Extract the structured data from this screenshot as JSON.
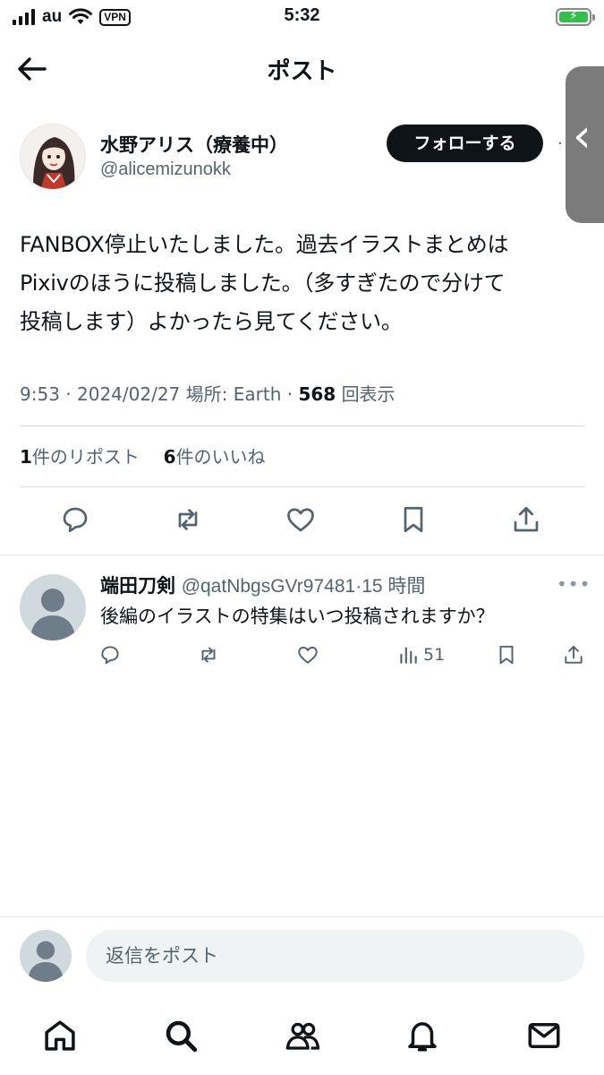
{
  "status_bar": {
    "carrier": "au",
    "vpn": "VPN",
    "time": "5:32"
  },
  "header": {
    "title": "ポスト"
  },
  "author": {
    "name": "水野アリス（療養中）",
    "handle": "@alicemizunokk",
    "follow_label": "フォローする"
  },
  "post": {
    "lines": [
      "FANBOX停止いたしました。過去イラストまとめは",
      "Pixivのほうに投稿しました。（多すぎたので分けて",
      "投稿します）よかったら見てください。"
    ],
    "time": "9:53",
    "date": "2024/02/27",
    "location": "場所: Earth",
    "views_count": "568",
    "views_label": "回表示",
    "reposts_count": "1",
    "reposts_label": "件のリポスト",
    "likes_count": "6",
    "likes_label": "件のいいね"
  },
  "reply": {
    "name": "端田刀剣",
    "handle": "@qatNbgsGVr97481",
    "age": "15 時間",
    "text": "後編のイラストの特集はいつ投稿されますか？",
    "views": "51"
  },
  "composer": {
    "placeholder": "返信をポスト"
  },
  "icons": [
    "back-arrow",
    "reply",
    "repost",
    "like",
    "bookmark",
    "share",
    "views",
    "home",
    "search",
    "communities",
    "notifications",
    "messages"
  ]
}
